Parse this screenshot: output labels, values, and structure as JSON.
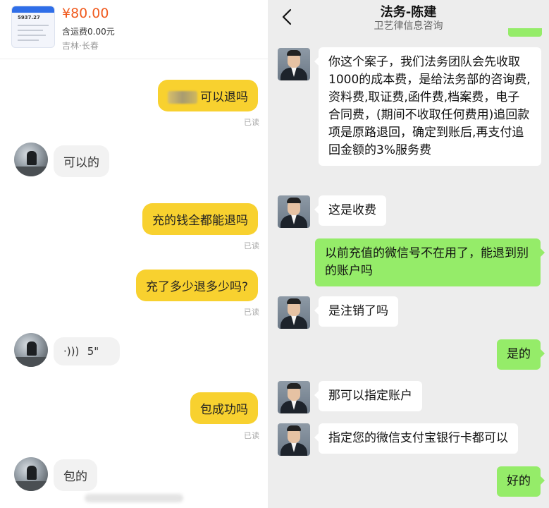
{
  "left": {
    "product": {
      "thumb_amount": "5937.27",
      "price": "¥80.00",
      "shipping": "含运费0.00元",
      "location": "吉林·长春"
    },
    "messages": [
      {
        "side": "right",
        "text": "可以退吗",
        "read": "已读"
      },
      {
        "side": "left",
        "text": "可以的"
      },
      {
        "side": "right",
        "text": "充的钱全都能退吗",
        "read": "已读"
      },
      {
        "side": "right",
        "text": "充了多少退多少吗?",
        "read": "已读"
      },
      {
        "side": "left",
        "voice_icon": "voice-wave-icon",
        "text": "5\""
      },
      {
        "side": "right",
        "text": "包成功吗",
        "read": "已读"
      },
      {
        "side": "left",
        "text": "包的"
      }
    ]
  },
  "right": {
    "header": {
      "title": "法务-陈建",
      "subtitle": "卫艺律信息咨询",
      "back_icon": "chevron-left-icon"
    },
    "messages": [
      {
        "side": "left",
        "text": "你这个案子，我们法务团队会先收取1000的成本费，是给法务部的咨询费,资料费,取证费,函件费,档案费，电子合同费，(期间不收取任何费用)追回款项是原路退回，确定到账后,再支付追回金额的3%服务费"
      },
      {
        "side": "left",
        "text": "这是收费"
      },
      {
        "side": "right",
        "text": "以前充值的微信号不在用了，能退到别的账户吗"
      },
      {
        "side": "left",
        "text": "是注销了吗"
      },
      {
        "side": "right",
        "text": "是的"
      },
      {
        "side": "left",
        "text": "那可以指定账户"
      },
      {
        "side": "left",
        "text": "指定您的微信支付宝银行卡都可以"
      },
      {
        "side": "right",
        "text": "好的"
      }
    ]
  },
  "colors": {
    "price": "#f05a1e",
    "yellow_bubble": "#f8d12f",
    "green_bubble": "#95ec69",
    "right_bg": "#ededed"
  }
}
